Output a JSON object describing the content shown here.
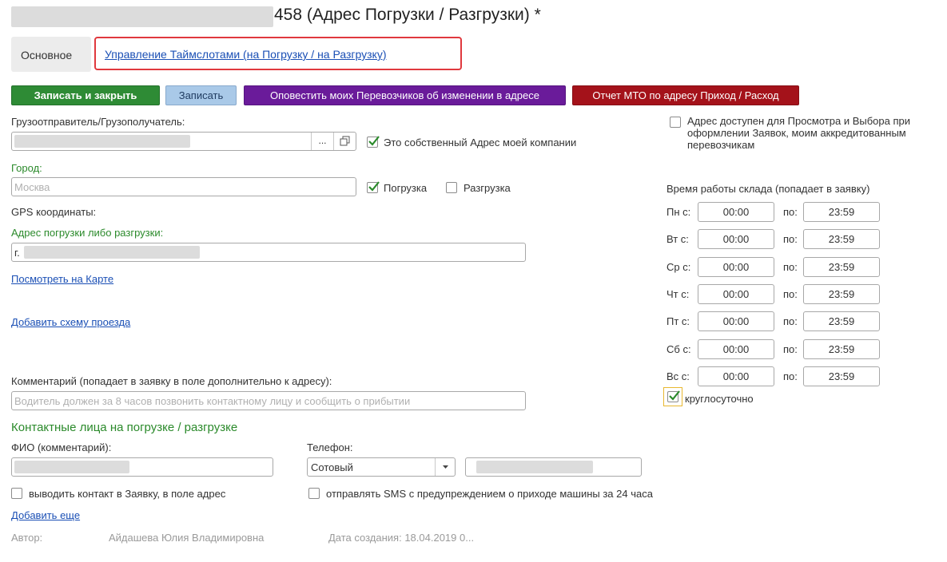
{
  "header": {
    "title_suffix": "458 (Адрес Погрузки / Разгрузки) *"
  },
  "tabs": {
    "main": "Основное",
    "timeslots": "Управление Таймслотами (на Погрузку / на Разгрузку)"
  },
  "toolbar": {
    "save_close": "Записать и закрыть",
    "save": "Записать",
    "notify": "Оповестить моих Перевозчиков об изменении в адресе",
    "report": "Отчет МТО по адресу Приход / Расход",
    "colors": {
      "save_close": "#2e8b35",
      "save": "#a9c9e8",
      "notify": "#6a1b9a",
      "report": "#a4121a"
    }
  },
  "form": {
    "shipper_label": "Грузоотправитель/Грузополучатель:",
    "ellipsis": "...",
    "own_address_label": "Это собственный Адрес моей компании",
    "city_label": "Город:",
    "city_placeholder": "Москва",
    "loading_label": "Погрузка",
    "unloading_label": "Разгрузка",
    "gps_label": "GPS координаты:",
    "address_label": "Адрес погрузки либо разгрузки:",
    "address_prefix": "г.",
    "view_map_link": "Посмотреть на Карте",
    "add_scheme_link": "Добавить схему проезда",
    "comment_label": "Комментарий (попадает в заявку в поле дополнительно к адресу):",
    "comment_placeholder": "Водитель должен за 8 часов позвонить контактному лицу и сообщить о прибытии",
    "contacts_header": "Контактные лица на погрузке / разгрузке",
    "fio_label": "ФИО (комментарий):",
    "phone_label": "Телефон:",
    "phone_type": "Сотовый",
    "show_contact_label": "выводить контакт в Заявку, в поле адрес",
    "sms_label": "отправлять SMS с предупреждением о приходе машины за 24 часа",
    "add_more_link": "Добавить еще",
    "author_label": "Автор:",
    "author_value": "Айдашева Юлия Владимировна",
    "created_label": "Дата создания: 18.04.2019 0..."
  },
  "right": {
    "available_label": "Адрес доступен для Просмотра и Выбора при оформлении Заявок, моим аккредитованным перевозчикам",
    "schedule_title": "Время работы склада (попадает в заявку)",
    "to_label": "по:",
    "days": [
      {
        "label": "Пн с:",
        "from": "00:00",
        "to": "23:59"
      },
      {
        "label": "Вт с:",
        "from": "00:00",
        "to": "23:59"
      },
      {
        "label": "Ср с:",
        "from": "00:00",
        "to": "23:59"
      },
      {
        "label": "Чт с:",
        "from": "00:00",
        "to": "23:59"
      },
      {
        "label": "Пт с:",
        "from": "00:00",
        "to": "23:59"
      },
      {
        "label": "Сб с:",
        "from": "00:00",
        "to": "23:59"
      },
      {
        "label": "Вс с:",
        "from": "00:00",
        "to": "23:59"
      }
    ],
    "round_clock_label": "круглосуточно"
  }
}
